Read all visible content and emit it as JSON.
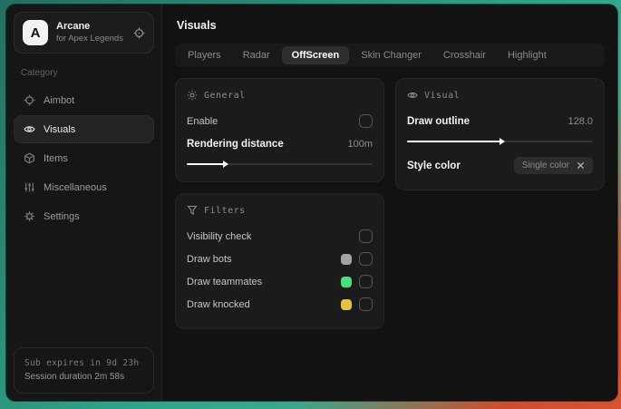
{
  "colors": {
    "background_teal": "#2fa68b",
    "background_orange": "#cc4e2e",
    "swatch_gray": "#a3a3a3",
    "swatch_green": "#4ade80",
    "swatch_yellow": "#e7c04a"
  },
  "sidebar": {
    "logo_letter": "A",
    "app_name": "Arcane",
    "app_subtitle": "for Apex Legends",
    "category_label": "Category",
    "items": [
      {
        "label": "Aimbot",
        "icon": "crosshair-icon"
      },
      {
        "label": "Visuals",
        "icon": "eye-icon"
      },
      {
        "label": "Items",
        "icon": "cube-icon"
      },
      {
        "label": "Miscellaneous",
        "icon": "sliders-icon"
      },
      {
        "label": "Settings",
        "icon": "gear-icon"
      }
    ],
    "footer": {
      "sub_expires": "Sub expires in 9d 23h",
      "session_duration": "Session duration 2m 58s"
    }
  },
  "main": {
    "title": "Visuals",
    "tabs": [
      {
        "label": "Players"
      },
      {
        "label": "Radar"
      },
      {
        "label": "OffScreen"
      },
      {
        "label": "Skin Changer"
      },
      {
        "label": "Crosshair"
      },
      {
        "label": "Highlight"
      }
    ],
    "general": {
      "title": "General",
      "enable_label": "Enable",
      "rendering_distance_label": "Rendering distance",
      "rendering_distance_value": "100m",
      "rendering_distance_fill": "20%"
    },
    "filters": {
      "title": "Filters",
      "rows": [
        {
          "label": "Visibility check",
          "swatch": ""
        },
        {
          "label": "Draw bots",
          "swatch": "#a3a3a3"
        },
        {
          "label": "Draw teammates",
          "swatch": "#4ade80"
        },
        {
          "label": "Draw knocked",
          "swatch": "#e7c04a"
        }
      ]
    },
    "visual": {
      "title": "Visual",
      "draw_outline_label": "Draw outline",
      "draw_outline_value": "128.0",
      "draw_outline_fill": "50%",
      "style_color_label": "Style color",
      "style_color_value": "Single color"
    }
  }
}
